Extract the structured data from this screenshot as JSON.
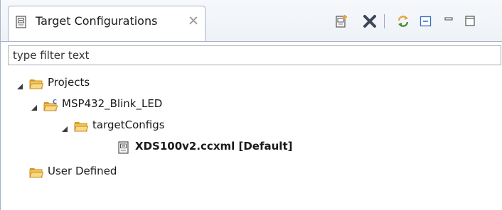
{
  "view": {
    "tab_title": "Target Configurations",
    "tab_icon": "target-config-icon",
    "close_icon": "close-x-icon"
  },
  "toolbar": {
    "items": [
      {
        "name": "new-target-configuration-icon"
      },
      {
        "name": "delete-icon"
      },
      {
        "name": "refresh-icon"
      },
      {
        "name": "collapse-all-icon"
      },
      {
        "name": "minimize-icon"
      },
      {
        "name": "maximize-icon"
      }
    ]
  },
  "filter": {
    "placeholder": "type filter text",
    "value": ""
  },
  "tree": {
    "projects": {
      "label": "Projects",
      "expanded": true,
      "icon": "folder-open-icon"
    },
    "project": {
      "label": "MSP432_Blink_LED",
      "expanded": true,
      "icon": "ccs-project-folder-icon"
    },
    "target_configs": {
      "label": "targetConfigs",
      "expanded": true,
      "icon": "folder-open-icon"
    },
    "file": {
      "label": "XDS100v2.ccxml [Default]",
      "icon": "ccxml-file-icon"
    },
    "user_defined": {
      "label": "User Defined",
      "icon": "folder-open-icon"
    }
  },
  "colors": {
    "folder": "#e8b64a",
    "project_accent": "#3a6fc4",
    "delete": "#3b4659",
    "refresh": "#e8a33a",
    "border": "#aab4c4"
  }
}
